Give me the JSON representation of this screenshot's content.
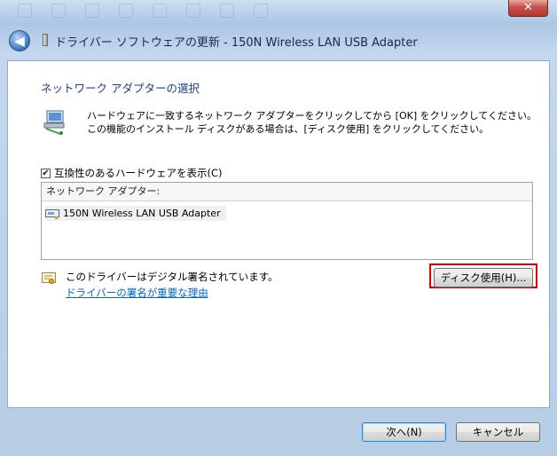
{
  "window": {
    "title": "ドライバー ソフトウェアの更新 - 150N Wireless LAN USB Adapter",
    "close_label": "✕"
  },
  "page": {
    "heading": "ネットワーク アダプターの選択",
    "instruction": "ハードウェアに一致するネットワーク アダプターをクリックしてから [OK] をクリックしてください。この機能のインストール ディスクがある場合は、[ディスク使用] をクリックしてください。",
    "show_compatible_label": "互換性のあるハードウェアを表示(C)",
    "show_compatible_checked": true
  },
  "adapter_list": {
    "header": "ネットワーク アダプター:",
    "items": [
      "150N Wireless LAN USB Adapter"
    ]
  },
  "signature": {
    "text": "このドライバーはデジタル署名されています。",
    "link": "ドライバーの署名が重要な理由"
  },
  "buttons": {
    "have_disk": "ディスク使用(H)...",
    "next": "次へ(N)",
    "cancel": "キャンセル"
  },
  "colors": {
    "highlight_border": "#e00000",
    "link": "#0066cc",
    "heading": "#1e3d8a"
  }
}
